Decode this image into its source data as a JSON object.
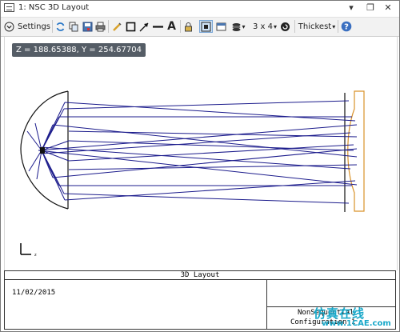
{
  "window": {
    "title": "1: NSC 3D Layout"
  },
  "toolbar": {
    "settings_label": "Settings",
    "layout_label": "3 x 4",
    "thickness_label": "Thickest"
  },
  "coordinate_readout": "Z = 188.65388, Y = 254.67704",
  "infobox": {
    "title": "3D Layout",
    "date": "11/02/2015",
    "nonsequential_label": "NonSequential",
    "config_label": "Configuration 1"
  },
  "watermark": {
    "text": "仿真在线",
    "url": "www.1CAE.com"
  },
  "colors": {
    "rays": "#1c1c8c",
    "lens": "#d9922a",
    "accent": "#1f5fb0"
  }
}
